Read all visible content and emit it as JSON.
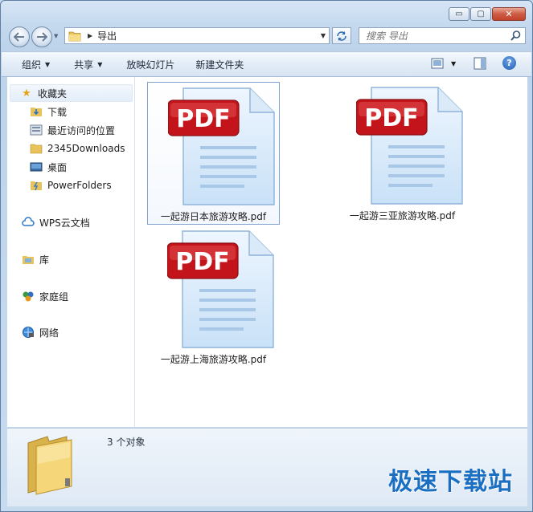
{
  "window": {
    "caption_buttons": {
      "minimize": "▭",
      "maximize": "▢",
      "close": "✕"
    }
  },
  "address": {
    "path_segment": "导出"
  },
  "search": {
    "placeholder": "搜索 导出"
  },
  "toolbar": {
    "organize": "组织",
    "share": "共享",
    "slideshow": "放映幻灯片",
    "new_folder": "新建文件夹"
  },
  "nav": {
    "favorites": "收藏夹",
    "favorites_items": [
      "下载",
      "最近访问的位置",
      "2345Downloads",
      "桌面",
      "PowerFolders"
    ],
    "wps_cloud": "WPS云文档",
    "libraries": "库",
    "homegroup": "家庭组",
    "network": "网络"
  },
  "files": [
    {
      "name": "一起游日本旅游攻略.pdf",
      "badge": "PDF"
    },
    {
      "name": "一起游三亚旅游攻略.pdf",
      "badge": "PDF"
    },
    {
      "name": "一起游上海旅游攻略.pdf",
      "badge": "PDF"
    }
  ],
  "details": {
    "count_text": "3 个对象"
  },
  "watermark": "极速下载站",
  "colors": {
    "pdf_badge": "#c4141b",
    "accent": "#1b6fc2",
    "selection_border": "#7ea3d2"
  }
}
